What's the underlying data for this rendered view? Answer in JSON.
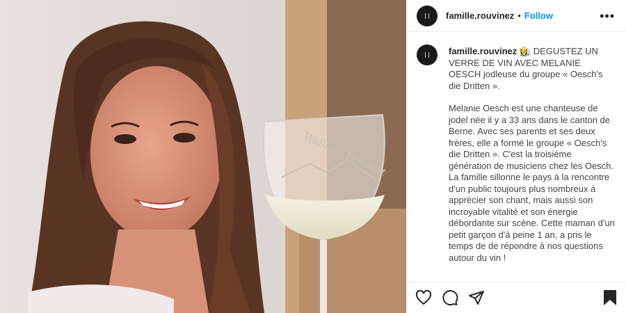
{
  "account": {
    "username": "famille.rouvinez",
    "follow_label": "Follow",
    "separator": "•"
  },
  "caption": {
    "username": "famille.rouvinez",
    "emoji": "👩‍🌾",
    "paragraph1": "DEGUSTEZ UN VERRE DE VIN AVEC MELANIE OESCH jodleuse du groupe « Oesch's die Dritten ».",
    "paragraph2": "Melanie Oesch est une chanteuse de jodel née il y a 33 ans dans le canton de Berne. Avec ses parents et ses deux frères, elle a formé le groupe « Oesch's die Dritten ». C'est la troisième génération de musiciens chez les Oesch. La famille sillonne le pays à la rencontre d'un public toujours plus nombreux à apprécier son chant, mais aussi son incroyable vitalité et son énergie débordante sur scène. Cette maman d'un petit garçon d'à peine 1 an, a pris le temps de de répondre à nos questions autour du vin !"
  },
  "actions": {
    "icons": [
      "heart-icon",
      "comment-icon",
      "share-icon",
      "bookmark-icon"
    ]
  },
  "glass_etching": "Walliser Fendant",
  "colors": {
    "accent": "#0095f6",
    "text": "#262626",
    "border": "#efefef"
  }
}
